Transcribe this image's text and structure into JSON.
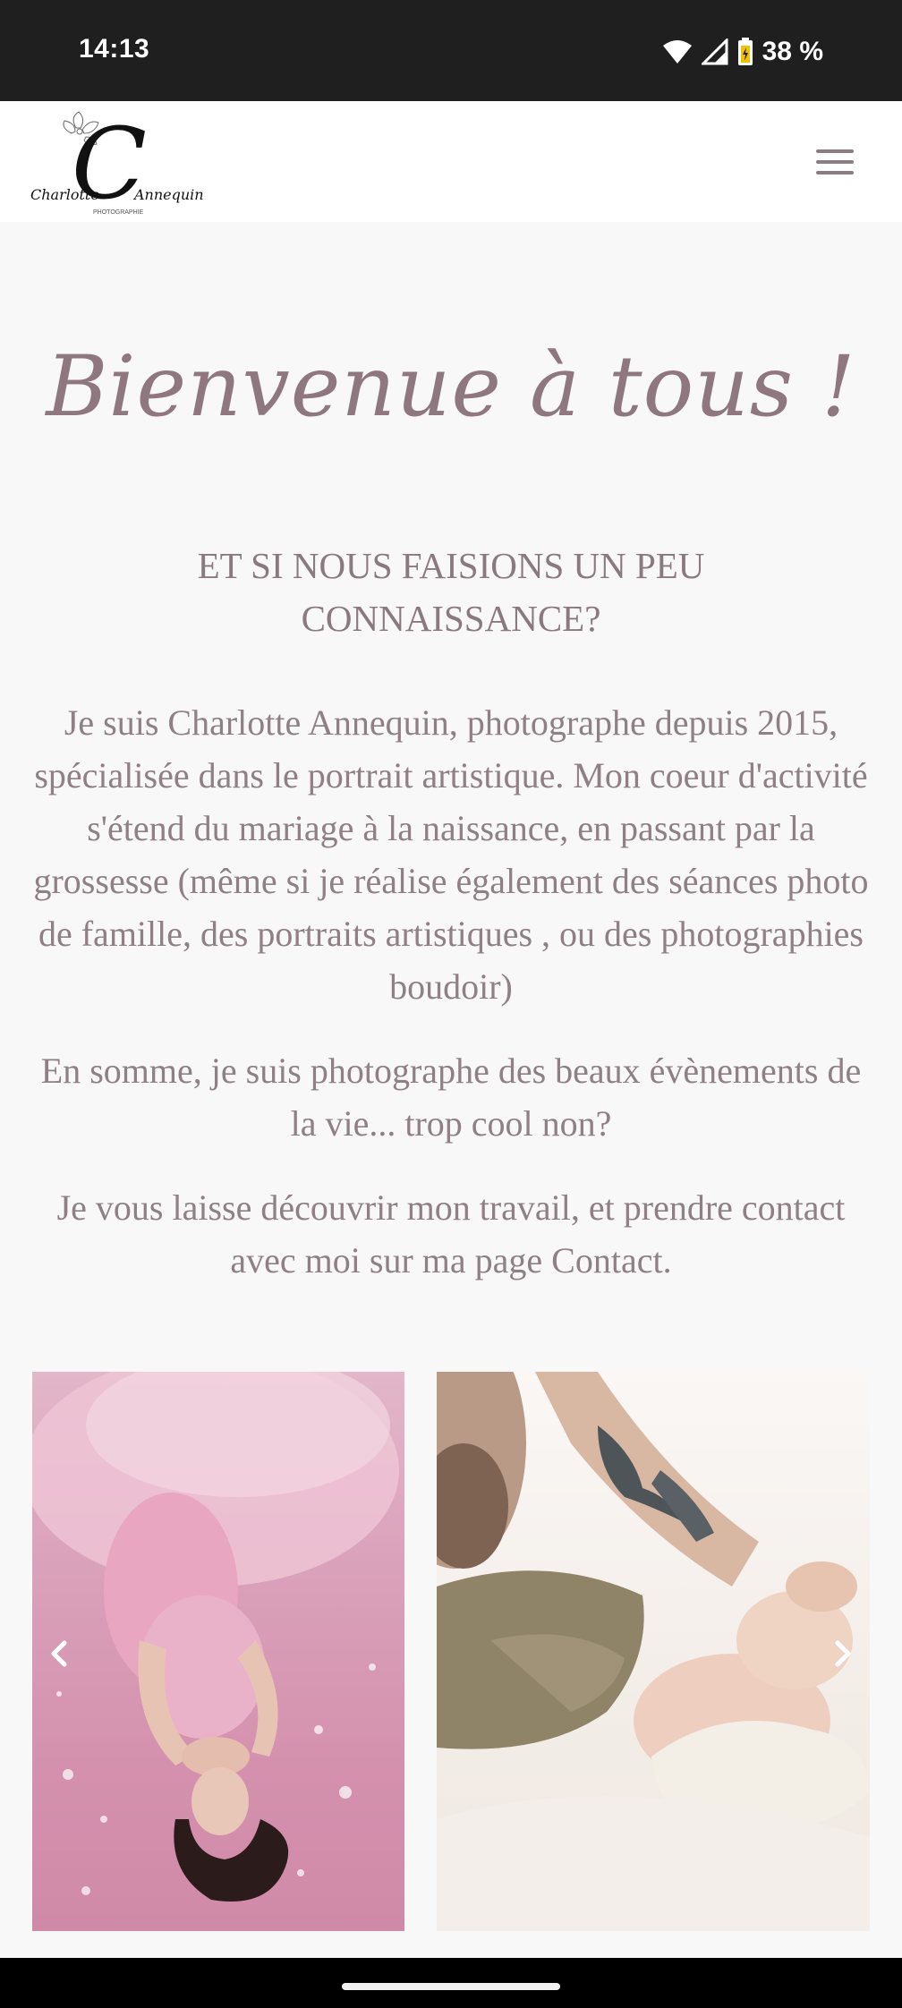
{
  "status_bar": {
    "time": "14:13",
    "battery": "38 %",
    "icons": [
      "wifi-icon",
      "signal-icon",
      "battery-icon"
    ]
  },
  "header": {
    "logo_name_first": "Charlotte",
    "logo_name_last": "Annequin",
    "logo_subtitle": "PHOTOGRAPHIE",
    "logo_initial": "C",
    "menu_icon": "hamburger-menu-icon"
  },
  "main": {
    "welcome": "Bienvenue à tous !",
    "subtitle": "ET SI NOUS FAISIONS UN PEU CONNAISSANCE?",
    "paragraphs": [
      "Je suis Charlotte Annequin, photographe depuis 2015, spécialisée dans le portrait artistique. Mon coeur d'activité s'étend du mariage à la naissance, en passant par la grossesse (même si je réalise également des séances photo de famille, des portraits artistiques , ou des photographies boudoir)",
      "En somme, je suis photographe des beaux évènements de la vie... trop cool non?",
      "Je vous laisse découvrir mon travail, et prendre contact avec moi sur ma page Contact."
    ]
  },
  "carousel": {
    "prev_icon": "chevron-left-icon",
    "next_icon": "chevron-right-icon"
  },
  "colors": {
    "accent": "#8f7780",
    "text": "#8e8085",
    "background": "#f9f8f9",
    "status_bar": "#1f1f1f"
  }
}
